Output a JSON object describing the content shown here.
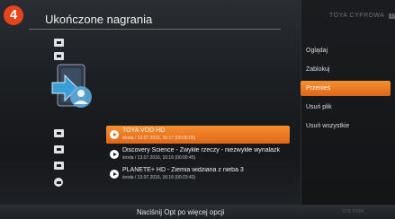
{
  "step_badge": "4",
  "header": {
    "title": "Ukończone nagrania"
  },
  "brand": {
    "name": "TOYA",
    "sub": "CYFROWA",
    "badge": "TV"
  },
  "sidebar_icons": [
    "folder-icon",
    "folder-icon",
    "folder-icon",
    "folder-icon",
    "folder-icon",
    "folder-icon"
  ],
  "recordings": [
    {
      "title": "TOYA VOD HD",
      "meta": "środa / 13.07.2016, 16:17 (00:00:05)",
      "selected": true
    },
    {
      "title": "Discovery Science - Zwykłe rzeczy - niezwykłe wynalazk",
      "meta": "środa / 13.07.2016, 16:16 (00:00:45)",
      "selected": false
    },
    {
      "title": "PLANETE+ HD - Ziemia widziana z nieba 3",
      "meta": "środa / 13.07.2016, 16:16 (00:23:42)",
      "selected": false
    }
  ],
  "menu": [
    {
      "label": "Oglądaj",
      "active": false
    },
    {
      "label": "Zablokuj",
      "active": false
    },
    {
      "label": "Przenieś",
      "active": true
    },
    {
      "label": "Usuń plik",
      "active": false
    },
    {
      "label": "Usuń wszystkie",
      "active": false
    }
  ],
  "footer": {
    "hint": "Naciśnij Opt po więcej opcji",
    "tag": "STB TOYA"
  },
  "colors": {
    "accent": "#e8751e",
    "badge": "#e8441c"
  }
}
